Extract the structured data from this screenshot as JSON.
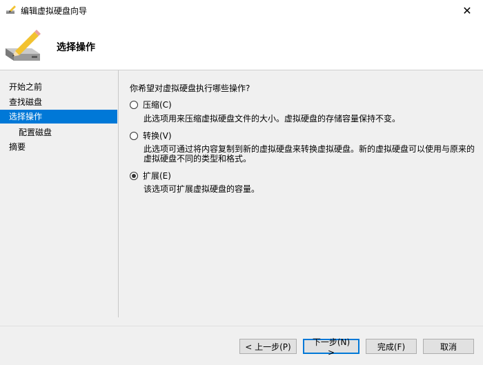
{
  "window": {
    "title": "编辑虚拟硬盘向导",
    "close_glyph": "✕"
  },
  "header": {
    "title": "选择操作",
    "icon": "disk-pencil-icon"
  },
  "nav": {
    "items": [
      {
        "label": "开始之前",
        "active": false,
        "sub": false
      },
      {
        "label": "查找磁盘",
        "active": false,
        "sub": false
      },
      {
        "label": "选择操作",
        "active": true,
        "sub": false
      },
      {
        "label": "配置磁盘",
        "active": false,
        "sub": true
      },
      {
        "label": "摘要",
        "active": false,
        "sub": false
      }
    ]
  },
  "content": {
    "question": "你希望对虚拟硬盘执行哪些操作?",
    "options": [
      {
        "label": "压缩(C)",
        "checked": false,
        "desc": "此选项用来压缩虚拟硬盘文件的大小。虚拟硬盘的存储容量保持不变。"
      },
      {
        "label": "转换(V)",
        "checked": false,
        "desc": "此选项可通过将内容复制到新的虚拟硬盘来转换虚拟硬盘。新的虚拟硬盘可以使用与原来的虚拟硬盘不同的类型和格式。"
      },
      {
        "label": "扩展(E)",
        "checked": true,
        "desc": "该选项可扩展虚拟硬盘的容量。"
      }
    ]
  },
  "footer": {
    "prev_label": "< 上一步(P)",
    "next_label": "下一步(N) >",
    "finish_label": "完成(F)",
    "cancel_label": "取消"
  },
  "colors": {
    "accent": "#0078d7",
    "background": "#f0f0f0",
    "header_bg": "#ffffff"
  }
}
